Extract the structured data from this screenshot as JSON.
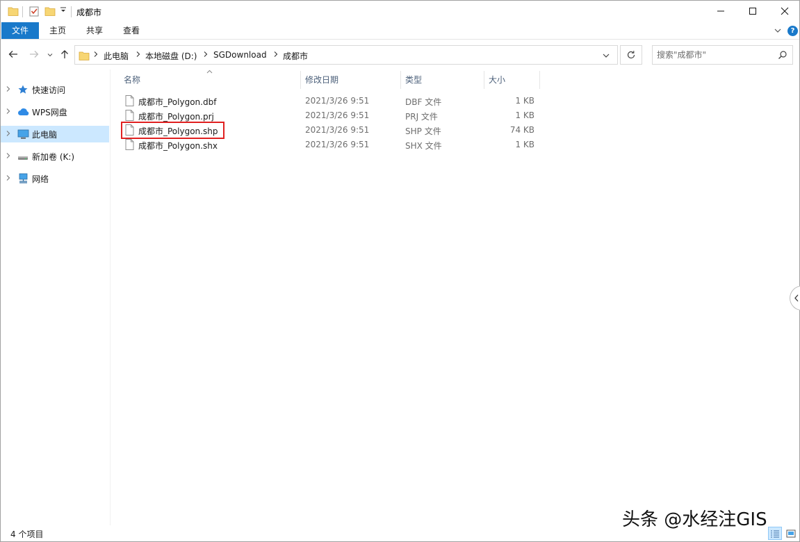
{
  "window": {
    "title": "成都市"
  },
  "ribbon": {
    "tabs": [
      {
        "label": "文件"
      },
      {
        "label": "主页"
      },
      {
        "label": "共享"
      },
      {
        "label": "查看"
      }
    ],
    "help_label": "?"
  },
  "address": {
    "crumbs": [
      "此电脑",
      "本地磁盘 (D:)",
      "SGDownload",
      "成都市"
    ]
  },
  "search": {
    "placeholder": "搜索\"成都市\""
  },
  "sidebar": {
    "items": [
      {
        "label": "快速访问",
        "icon": "star-icon"
      },
      {
        "label": "WPS网盘",
        "icon": "cloud-icon"
      },
      {
        "label": "此电脑",
        "icon": "computer-icon",
        "selected": true
      },
      {
        "label": "新加卷 (K:)",
        "icon": "drive-icon"
      },
      {
        "label": "网络",
        "icon": "network-icon"
      }
    ]
  },
  "columns": {
    "name": "名称",
    "date": "修改日期",
    "type": "类型",
    "size": "大小"
  },
  "files": [
    {
      "name": "成都市_Polygon.dbf",
      "date": "2021/3/26 9:51",
      "type": "DBF 文件",
      "size": "1 KB"
    },
    {
      "name": "成都市_Polygon.prj",
      "date": "2021/3/26 9:51",
      "type": "PRJ 文件",
      "size": "1 KB"
    },
    {
      "name": "成都市_Polygon.shp",
      "date": "2021/3/26 9:51",
      "type": "SHP 文件",
      "size": "74 KB",
      "highlighted": true
    },
    {
      "name": "成都市_Polygon.shx",
      "date": "2021/3/26 9:51",
      "type": "SHX 文件",
      "size": "1 KB"
    }
  ],
  "status": {
    "item_count": "4 个项目"
  },
  "watermark": "头条 @水经注GIS",
  "colors": {
    "accent": "#1979ca",
    "selection": "#cce8ff",
    "highlight_border": "#e02020"
  }
}
